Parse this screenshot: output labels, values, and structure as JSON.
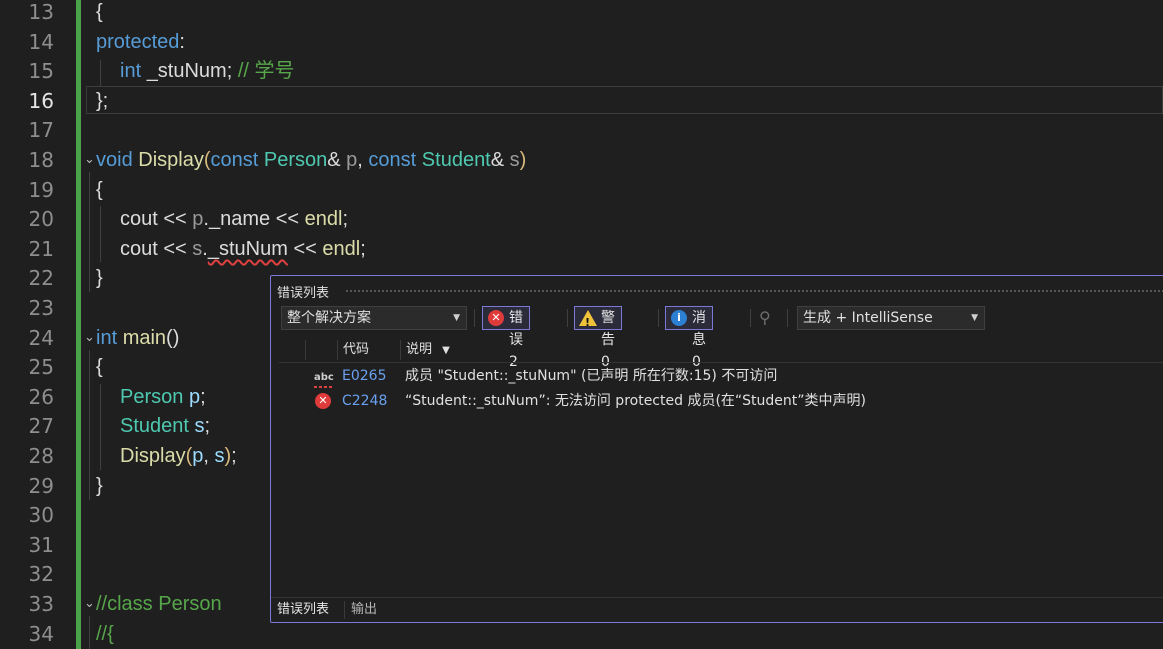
{
  "editor": {
    "line_numbers": [
      "13",
      "14",
      "15",
      "16",
      "17",
      "18",
      "19",
      "20",
      "21",
      "22",
      "23",
      "24",
      "25",
      "26",
      "27",
      "28",
      "29",
      "30",
      "31",
      "32",
      "33",
      "34"
    ],
    "active_line": "16",
    "code": {
      "l13": "{",
      "l14_kw": "protected",
      "l14_colon": ":",
      "l15_type": "int",
      "l15_var": "_stuNum",
      "l15_semi": ";",
      "l15_comment": "// 学号",
      "l16": "};",
      "l18_void": "void",
      "l18_fn": "Display",
      "l18_open": "(",
      "l18_const1": "const",
      "l18_type1": "Person",
      "l18_amp1": "&",
      "l18_p": "p",
      "l18_comma": ",",
      "l18_const2": "const",
      "l18_type2": "Student",
      "l18_amp2": "&",
      "l18_s": "s",
      "l18_close": ")",
      "l19": "{",
      "l20_cout": "cout",
      "l20_op1": "<<",
      "l20_p": "p",
      "l20_dot": ".",
      "l20_member": "_name",
      "l20_op2": "<<",
      "l20_endl": "endl",
      "l20_semi": ";",
      "l21_cout": "cout",
      "l21_op1": "<<",
      "l21_s": "s",
      "l21_dot": ".",
      "l21_member": "_stuNum",
      "l21_op2": "<<",
      "l21_endl": "endl",
      "l21_semi": ";",
      "l22": "}",
      "l24_int": "int",
      "l24_main": "main",
      "l24_parens": "()",
      "l25": "{",
      "l26_type": "Person",
      "l26_var": "p",
      "l26_semi": ";",
      "l27_type": "Student",
      "l27_var": "s",
      "l27_semi": ";",
      "l28_fn": "Display",
      "l28_open": "(",
      "l28_p": "p",
      "l28_comma": ",",
      "l28_s": "s",
      "l28_close": ")",
      "l28_semi": ";",
      "l29": "}",
      "l33_comment": "//class Person",
      "l34_comment": "//{"
    }
  },
  "error_list": {
    "title": "错误列表",
    "scope_value": "整个解决方案",
    "errors_label": "错误 2",
    "warnings_label": "警告 0",
    "messages_label": "消息 0",
    "build_value": "生成 + IntelliSense",
    "col_code": "代码",
    "col_desc": "说明",
    "rows": [
      {
        "icon": "spell-error-icon",
        "code": "E0265",
        "desc": "成员 \"Student::_stuNum\" (已声明 所在行数:15) 不可访问"
      },
      {
        "icon": "error-circle-icon",
        "code": "C2248",
        "desc": "“Student::_stuNum”: 无法访问 protected 成员(在“Student”类中声明)"
      }
    ],
    "tabs": [
      "错误列表",
      "输出"
    ]
  },
  "colors": {
    "accent": "#7b78d8",
    "error": "#e03b3b",
    "warning": "#f0c23a",
    "info": "#2d7fd4",
    "change_bar": "#4aa34a"
  }
}
